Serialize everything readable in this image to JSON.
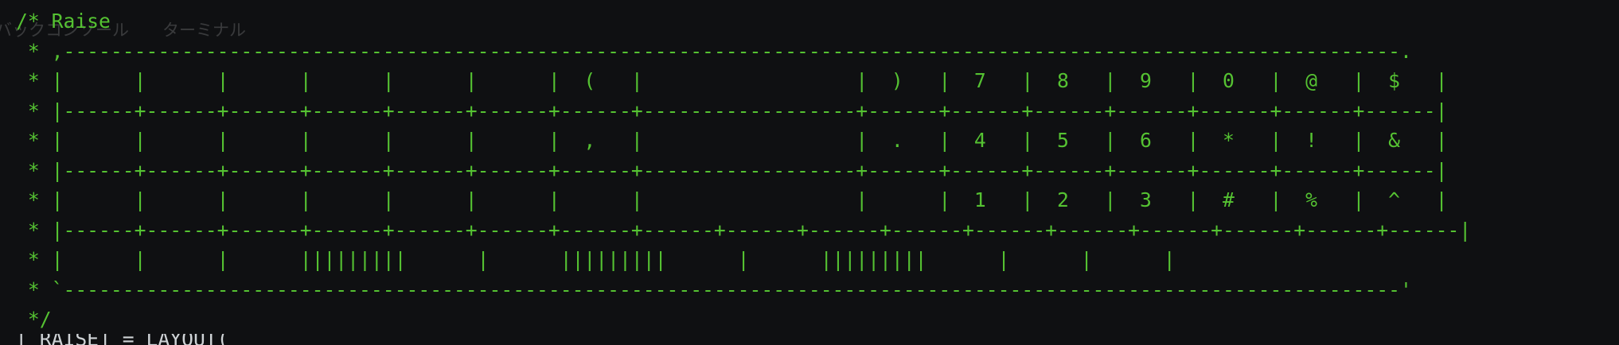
{
  "editor": {
    "ghost_tabs": [
      "バックコンソール",
      "ターミナル"
    ],
    "lines": [
      "/* Raise",
      " * ,-----------------------------------------------------------------------------------------------------------------.",
      " * |      |      |      |      |      |      |  (   |                  |  )   |  7   |  8   |  9   |  0   |  @   |  $   |",
      " * |------+------+------+------+------+------+------+------------------+------+------+------+------+------+------+------|",
      " * |      |      |      |      |      |      |  ,   |                  |  .   |  4   |  5   |  6   |  *   |  !   |  &   |",
      " * |------+------+------+------+------+------+------+------------------+------+------+------+------+------+------+------|",
      " * |      |      |      |      |      |      |      |                  |      |  1   |  2   |  3   |  #   |  %   |  ^   |",
      " * |------+------+------+------+------+------+------+------+------+------+------+------+------+------+------+------+------|",
      " * |      |      |      |||||||||      |      |||||||||      |      |||||||||      |      |      |",
      " * `-----------------------------------------------------------------------------------------------------------------'",
      " */"
    ],
    "cutoff_line": "[_RAISE] = LAYOUT("
  }
}
